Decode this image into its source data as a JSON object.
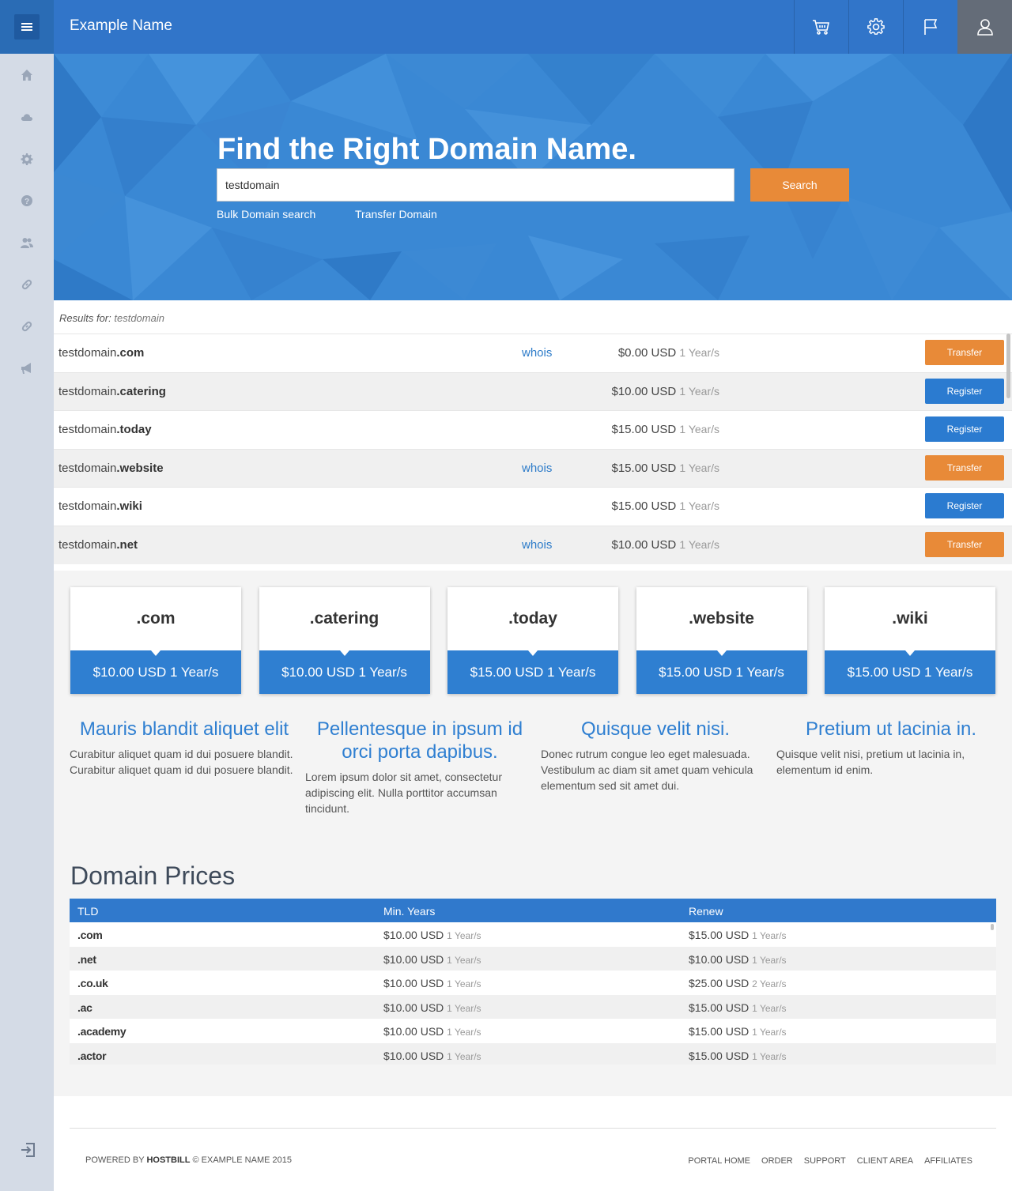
{
  "brand": "Example Name",
  "hero": {
    "title": "Find the Right Domain Name.",
    "search_value": "testdomain",
    "search_button": "Search",
    "links": [
      "Bulk Domain search",
      "Transfer Domain"
    ]
  },
  "results": {
    "label": "Results for:",
    "query": "testdomain",
    "rows": [
      {
        "name": "testdomain",
        "tld": ".com",
        "whois": "whois",
        "price": "$0.00 USD",
        "period": "1 Year/s",
        "action": "Transfer"
      },
      {
        "name": "testdomain",
        "tld": ".catering",
        "whois": "",
        "price": "$10.00 USD",
        "period": "1 Year/s",
        "action": "Register"
      },
      {
        "name": "testdomain",
        "tld": ".today",
        "whois": "",
        "price": "$15.00 USD",
        "period": "1 Year/s",
        "action": "Register"
      },
      {
        "name": "testdomain",
        "tld": ".website",
        "whois": "whois",
        "price": "$15.00 USD",
        "period": "1 Year/s",
        "action": "Transfer"
      },
      {
        "name": "testdomain",
        "tld": ".wiki",
        "whois": "",
        "price": "$15.00 USD",
        "period": "1 Year/s",
        "action": "Register"
      },
      {
        "name": "testdomain",
        "tld": ".net",
        "whois": "whois",
        "price": "$10.00 USD",
        "period": "1 Year/s",
        "action": "Transfer"
      }
    ]
  },
  "cards": [
    {
      "tld": ".com",
      "price": "$10.00 USD 1 Year/s"
    },
    {
      "tld": ".catering",
      "price": "$10.00 USD 1 Year/s"
    },
    {
      "tld": ".today",
      "price": "$15.00 USD 1 Year/s"
    },
    {
      "tld": ".website",
      "price": "$15.00 USD 1 Year/s"
    },
    {
      "tld": ".wiki",
      "price": "$15.00 USD 1 Year/s"
    }
  ],
  "features": [
    {
      "title": "Mauris blandit aliquet elit",
      "text": "Curabitur aliquet quam id dui posuere blandit. Curabitur aliquet quam id dui posuere blandit."
    },
    {
      "title": "Pellentesque in ipsum id orci porta dapibus.",
      "text": "Lorem ipsum dolor sit amet, consectetur adipiscing elit. Nulla porttitor accumsan tincidunt."
    },
    {
      "title": "Quisque velit nisi.",
      "text": "Donec rutrum congue leo eget malesuada. Vestibulum ac diam sit amet quam vehicula elementum sed sit amet dui."
    },
    {
      "title": "Pretium ut lacinia in.",
      "text": "Quisque velit nisi, pretium ut lacinia in, elementum id enim."
    }
  ],
  "domain_prices": {
    "title": "Domain Prices",
    "columns": [
      "TLD",
      "Min. Years",
      "Renew"
    ],
    "rows": [
      {
        "tld": ".com",
        "min_price": "$10.00 USD",
        "min_period": "1 Year/s",
        "renew_price": "$15.00 USD",
        "renew_period": "1 Year/s"
      },
      {
        "tld": ".net",
        "min_price": "$10.00 USD",
        "min_period": "1 Year/s",
        "renew_price": "$10.00 USD",
        "renew_period": "1 Year/s"
      },
      {
        "tld": ".co.uk",
        "min_price": "$10.00 USD",
        "min_period": "1 Year/s",
        "renew_price": "$25.00 USD",
        "renew_period": "2 Year/s"
      },
      {
        "tld": ".ac",
        "min_price": "$10.00 USD",
        "min_period": "1 Year/s",
        "renew_price": "$15.00 USD",
        "renew_period": "1 Year/s"
      },
      {
        "tld": ".academy",
        "min_price": "$10.00 USD",
        "min_period": "1 Year/s",
        "renew_price": "$15.00 USD",
        "renew_period": "1 Year/s"
      },
      {
        "tld": ".actor",
        "min_price": "$10.00 USD",
        "min_period": "1 Year/s",
        "renew_price": "$15.00 USD",
        "renew_period": "1 Year/s"
      }
    ]
  },
  "footer": {
    "powered_prefix": "POWERED BY",
    "powered_brand": "HOSTBILL",
    "powered_suffix": "© EXAMPLE NAME 2015",
    "links": [
      "PORTAL HOME",
      "ORDER",
      "SUPPORT",
      "CLIENT AREA",
      "AFFILIATES"
    ]
  },
  "icons": {
    "sidebar": [
      "home-icon",
      "cloud-icon",
      "gear-icon",
      "help-icon",
      "users-icon",
      "link-icon",
      "link-icon",
      "megaphone-icon"
    ],
    "topbar": [
      "cart-icon",
      "settings-icon",
      "flag-icon",
      "user-icon"
    ],
    "logout": "logout-icon"
  },
  "colors": {
    "primary": "#3175c9",
    "accent": "#e88a38",
    "register": "#2b7bd0"
  }
}
